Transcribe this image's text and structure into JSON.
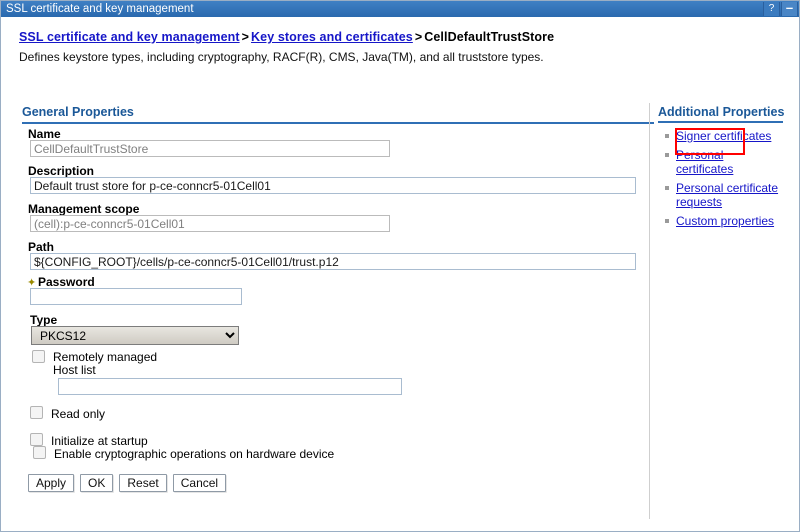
{
  "window": {
    "title": "SSL certificate and key management",
    "help_button": "?",
    "minimize_button": "–"
  },
  "breadcrumb": {
    "items": [
      {
        "label": "SSL certificate and key management",
        "link": true
      },
      {
        "label": "Key stores and certificates",
        "link": true
      },
      {
        "label": "CellDefaultTrustStore",
        "link": false
      }
    ],
    "separator": ">"
  },
  "page": {
    "subtitle": "Defines keystore types, including cryptography, RACF(R), CMS, Java(TM), and all truststore types."
  },
  "general_properties": {
    "heading": "General Properties",
    "fields": {
      "name": {
        "label": "Name",
        "value": "CellDefaultTrustStore",
        "readonly": true
      },
      "description": {
        "label": "Description",
        "value": "Default trust store for p-ce-conncr5-01Cell01",
        "readonly": false
      },
      "management_scope": {
        "label": "Management scope",
        "value": "(cell):p-ce-conncr5-01Cell01",
        "readonly": true
      },
      "path": {
        "label": "Path",
        "value": "${CONFIG_ROOT}/cells/p-ce-conncr5-01Cell01/trust.p12",
        "readonly": false
      },
      "password": {
        "label": "Password",
        "value": "",
        "required_marker": "✦",
        "readonly": false
      },
      "type": {
        "label": "Type",
        "value": "PKCS12",
        "options": [
          "PKCS12"
        ]
      },
      "host_list": {
        "label": "Host list",
        "value": "",
        "readonly": false
      }
    },
    "checkboxes": [
      {
        "label": "Remotely managed",
        "checked": false
      },
      {
        "label": "Read only",
        "checked": false
      },
      {
        "label": "Initialize at startup",
        "checked": false
      },
      {
        "label": "Enable cryptographic operations on hardware device",
        "checked": false
      }
    ]
  },
  "buttons": {
    "apply": "Apply",
    "ok": "OK",
    "reset": "Reset",
    "cancel": "Cancel"
  },
  "additional_properties": {
    "heading": "Additional Properties",
    "links": [
      {
        "label": "Signer certificates",
        "highlighted": true
      },
      {
        "label": "Personal certificates",
        "highlighted": false
      },
      {
        "label": "Personal certificate requests",
        "highlighted": false
      },
      {
        "label": "Custom properties",
        "highlighted": false
      }
    ]
  },
  "colors": {
    "titlebar": "#2f6fb5",
    "heading": "#1b5898",
    "link": "#1616c8",
    "highlight": "#ff0000"
  }
}
